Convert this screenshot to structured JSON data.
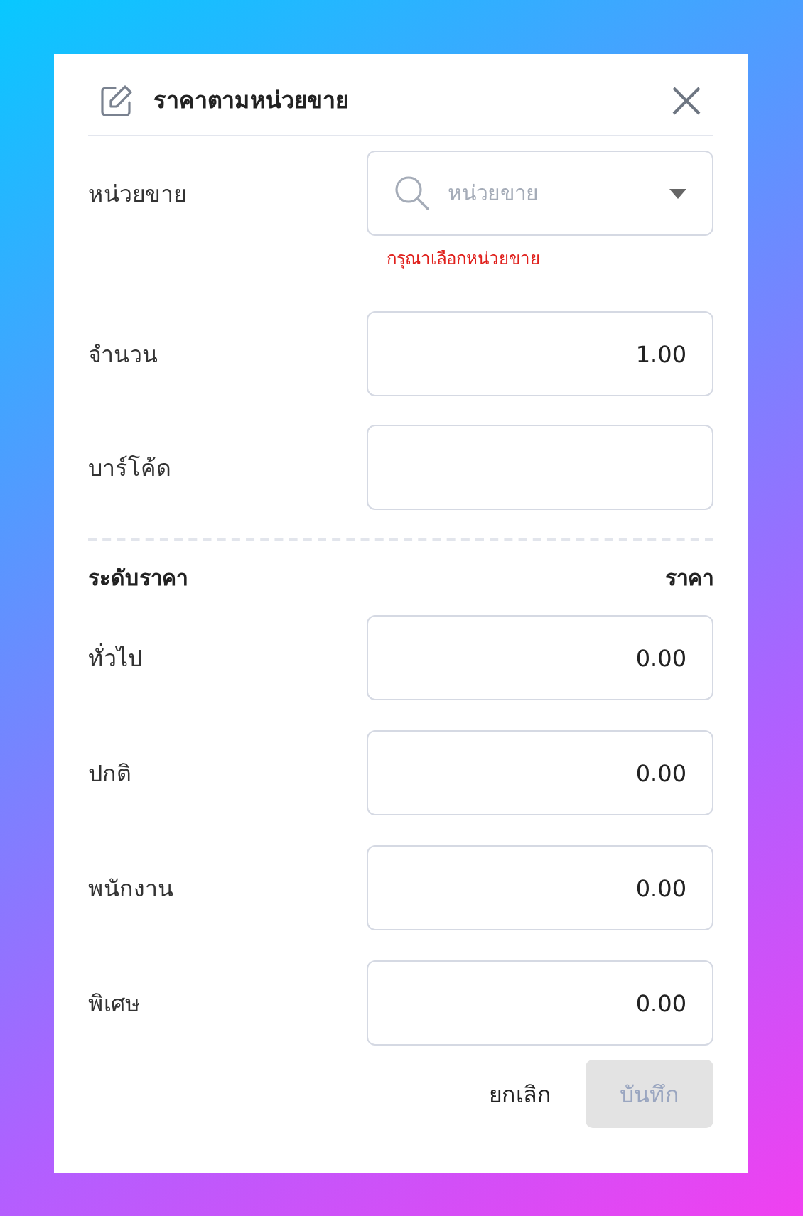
{
  "dialog": {
    "title": "ราคาตามหน่วยขาย",
    "fields": [
      {
        "label": "หน่วยขาย",
        "kind": "select",
        "placeholder": "หน่วยขาย",
        "error": "กรุณาเลือกหน่วยขาย"
      },
      {
        "label": "จำนวน",
        "kind": "number",
        "value": "1.00"
      },
      {
        "label": "บาร์โค้ด",
        "kind": "text"
      }
    ],
    "price_table": {
      "columns": [
        "ระดับราคา",
        "ราคา"
      ],
      "rows": [
        {
          "level": "ทั่วไป",
          "price": "0.00"
        },
        {
          "level": "ปกติ",
          "price": "0.00"
        },
        {
          "level": "พนักงาน",
          "price": "0.00"
        },
        {
          "level": "พิเศษ",
          "price": "0.00"
        }
      ]
    },
    "buttons": [
      {
        "label": "ยกเลิก",
        "kind": "text",
        "disabled": false
      },
      {
        "label": "บันทึก",
        "kind": "primary",
        "disabled": true
      }
    ]
  }
}
